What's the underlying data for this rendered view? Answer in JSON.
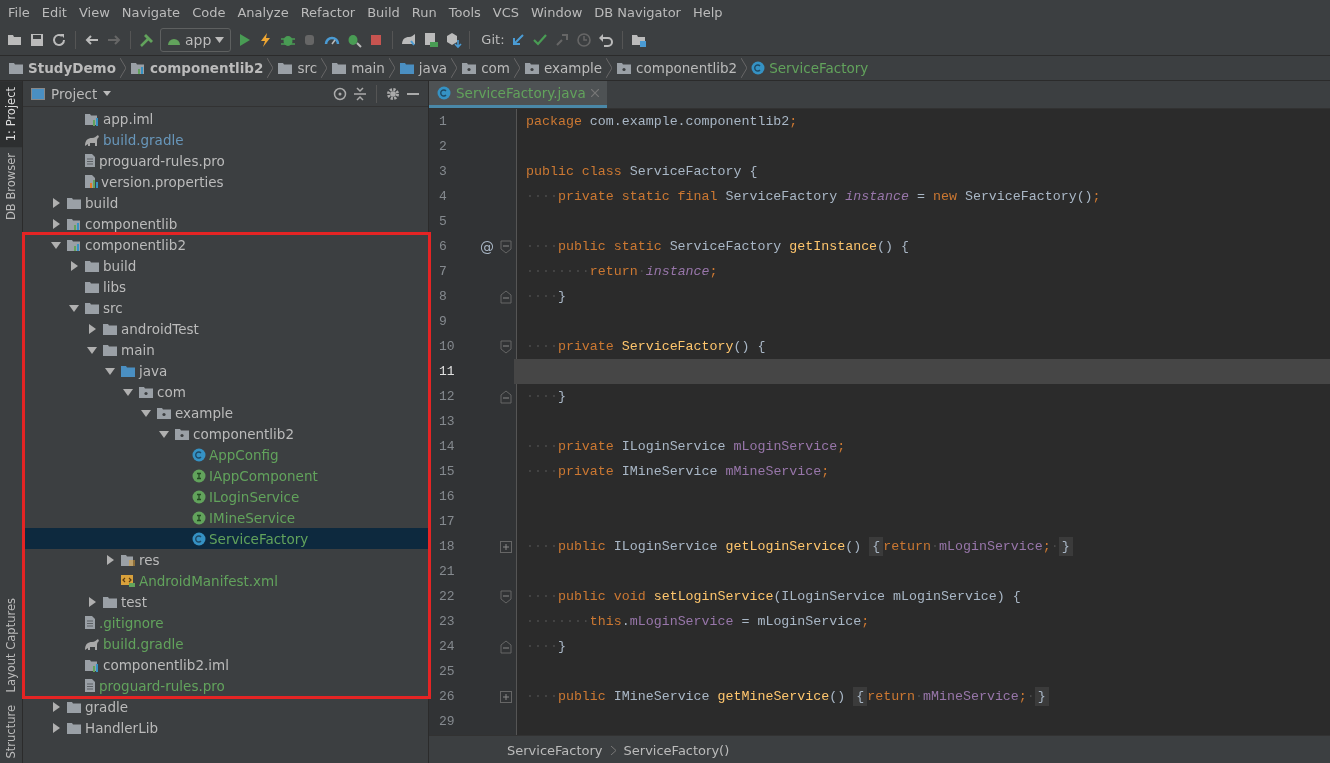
{
  "menu_bar": {
    "items": [
      "File",
      "Edit",
      "View",
      "Navigate",
      "Code",
      "Analyze",
      "Refactor",
      "Build",
      "Run",
      "Tools",
      "VCS",
      "Window",
      "DB Navigator",
      "Help"
    ]
  },
  "toolbar": {
    "run_config": "app",
    "git_label": "Git:"
  },
  "breadcrumb": [
    {
      "label": "StudyDemo",
      "kind": "project"
    },
    {
      "label": "componentlib2",
      "kind": "module"
    },
    {
      "label": "src",
      "kind": "folder"
    },
    {
      "label": "main",
      "kind": "folder"
    },
    {
      "label": "java",
      "kind": "source"
    },
    {
      "label": "com",
      "kind": "package"
    },
    {
      "label": "example",
      "kind": "package"
    },
    {
      "label": "componentlib2",
      "kind": "package"
    },
    {
      "label": "ServiceFactory",
      "kind": "class"
    }
  ],
  "tool_strip": {
    "top": [
      {
        "label": "1: Project",
        "selected": true
      },
      {
        "label": "DB Browser",
        "selected": false
      }
    ],
    "bottom": [
      {
        "label": "Layout Captures",
        "selected": false
      },
      {
        "label": "Structure",
        "selected": false
      }
    ]
  },
  "project_panel": {
    "title": "Project",
    "continued_items": [
      {
        "label": "app.iml",
        "kind": "iml",
        "color": "#bbbbbb",
        "selected": false
      },
      {
        "label": "build.gradle",
        "kind": "gradle",
        "color": "#6897bb",
        "selected": false
      },
      {
        "label": "proguard-rules.pro",
        "kind": "file",
        "color": "#bbbbbb",
        "selected": false
      },
      {
        "label": "version.properties",
        "kind": "properties",
        "color": "#bbbbbb",
        "selected": false
      }
    ],
    "items": [
      {
        "label": "build",
        "kind": "folder",
        "color": "#bbbbbb",
        "selected": false,
        "expanded": false
      },
      {
        "label": "componentlib",
        "kind": "module",
        "color": "#bbbbbb",
        "selected": false,
        "expanded": false
      },
      {
        "label": "componentlib2",
        "kind": "module",
        "color": "#bbbbbb",
        "selected": false,
        "expanded": true,
        "children": [
          {
            "label": "build",
            "kind": "folder",
            "color": "#bbbbbb",
            "selected": false,
            "expanded": false
          },
          {
            "label": "libs",
            "kind": "folder",
            "color": "#bbbbbb",
            "selected": false
          },
          {
            "label": "src",
            "kind": "folder",
            "color": "#bbbbbb",
            "selected": false,
            "expanded": true,
            "children": [
              {
                "label": "androidTest",
                "kind": "folder",
                "color": "#bbbbbb",
                "selected": false,
                "expanded": false
              },
              {
                "label": "main",
                "kind": "folder",
                "color": "#bbbbbb",
                "selected": false,
                "expanded": true,
                "children": [
                  {
                    "label": "java",
                    "kind": "source",
                    "color": "#bbbbbb",
                    "selected": false,
                    "expanded": true,
                    "children": [
                      {
                        "label": "com",
                        "kind": "package",
                        "color": "#bbbbbb",
                        "selected": false,
                        "expanded": true,
                        "children": [
                          {
                            "label": "example",
                            "kind": "package",
                            "color": "#bbbbbb",
                            "selected": false,
                            "expanded": true,
                            "children": [
                              {
                                "label": "componentlib2",
                                "kind": "package",
                                "color": "#bbbbbb",
                                "selected": false,
                                "expanded": true,
                                "children": [
                                  {
                                    "label": "AppConfig",
                                    "kind": "class",
                                    "color": "#62a35c",
                                    "selected": false
                                  },
                                  {
                                    "label": "IAppComponent",
                                    "kind": "interface",
                                    "color": "#62a35c",
                                    "selected": false
                                  },
                                  {
                                    "label": "ILoginService",
                                    "kind": "interface",
                                    "color": "#62a35c",
                                    "selected": false
                                  },
                                  {
                                    "label": "IMineService",
                                    "kind": "interface",
                                    "color": "#62a35c",
                                    "selected": false
                                  },
                                  {
                                    "label": "ServiceFactory",
                                    "kind": "class",
                                    "color": "#62a35c",
                                    "selected": true
                                  }
                                ]
                              }
                            ]
                          }
                        ]
                      }
                    ]
                  },
                  {
                    "label": "res",
                    "kind": "res",
                    "color": "#bbbbbb",
                    "selected": false,
                    "expanded": false
                  },
                  {
                    "label": "AndroidManifest.xml",
                    "kind": "manifest",
                    "color": "#62a35c",
                    "selected": false
                  }
                ]
              },
              {
                "label": "test",
                "kind": "folder",
                "color": "#bbbbbb",
                "selected": false,
                "expanded": false
              }
            ]
          },
          {
            "label": ".gitignore",
            "kind": "file",
            "color": "#62a35c",
            "selected": false
          },
          {
            "label": "build.gradle",
            "kind": "gradle",
            "color": "#62a35c",
            "selected": false
          },
          {
            "label": "componentlib2.iml",
            "kind": "iml",
            "color": "#bbbbbb",
            "selected": false
          },
          {
            "label": "proguard-rules.pro",
            "kind": "file",
            "color": "#62a35c",
            "selected": false
          }
        ]
      },
      {
        "label": "gradle",
        "kind": "folder",
        "color": "#bbbbbb",
        "selected": false,
        "expanded": false
      },
      {
        "label": "HandlerLib",
        "kind": "folder",
        "color": "#bbbbbb",
        "selected": false,
        "expanded": false
      }
    ]
  },
  "editor": {
    "tabs": [
      {
        "label": "ServiceFactory.java",
        "selected": true
      }
    ],
    "lines": [
      {
        "number": "1",
        "current": false,
        "tokens": [
          {
            "t": "package",
            "kind": "kw"
          },
          {
            "t": " com.example.componentlib2",
            "kind": "plain"
          },
          {
            "t": ";",
            "kind": "kw"
          }
        ]
      },
      {
        "number": "2",
        "current": false
      },
      {
        "number": "3",
        "current": false,
        "tokens": [
          {
            "t": "public class",
            "kind": "kw"
          },
          {
            "t": " ServiceFactory {",
            "kind": "plain"
          }
        ]
      },
      {
        "number": "4",
        "current": false,
        "tokens": [
          {
            "t": "····",
            "kind": "ws"
          },
          {
            "t": "private static final",
            "kind": "kw"
          },
          {
            "t": " ServiceFactory ",
            "kind": "plain"
          },
          {
            "t": "instance",
            "kind": "static"
          },
          {
            "t": " = ",
            "kind": "plain"
          },
          {
            "t": "new",
            "kind": "kw"
          },
          {
            "t": " ServiceFactory()",
            "kind": "plain"
          },
          {
            "t": ";",
            "kind": "kw"
          }
        ]
      },
      {
        "number": "5",
        "current": false
      },
      {
        "number": "6",
        "current": false,
        "mark": "@",
        "fold_start": true,
        "tokens": [
          {
            "t": "····",
            "kind": "ws"
          },
          {
            "t": "public static",
            "kind": "kw"
          },
          {
            "t": " ServiceFactory ",
            "kind": "plain"
          },
          {
            "t": "getInstance",
            "kind": "fn"
          },
          {
            "t": "() {",
            "kind": "plain"
          }
        ]
      },
      {
        "number": "7",
        "current": false,
        "tokens": [
          {
            "t": "········",
            "kind": "ws"
          },
          {
            "t": "return",
            "kind": "kw"
          },
          {
            "t": "·",
            "kind": "ws"
          },
          {
            "t": "instance",
            "kind": "static"
          },
          {
            "t": ";",
            "kind": "kw"
          }
        ]
      },
      {
        "number": "8",
        "current": false,
        "fold_end": true,
        "tokens": [
          {
            "t": "····",
            "kind": "ws"
          },
          {
            "t": "}",
            "kind": "plain"
          }
        ]
      },
      {
        "number": "9",
        "current": false
      },
      {
        "number": "10",
        "current": false,
        "fold_start": true,
        "tokens": [
          {
            "t": "····",
            "kind": "ws"
          },
          {
            "t": "private ",
            "kind": "kw"
          },
          {
            "t": "ServiceFactory",
            "kind": "fn"
          },
          {
            "t": "() {",
            "kind": "plain"
          }
        ]
      },
      {
        "number": "11",
        "current": true
      },
      {
        "number": "12",
        "current": false,
        "fold_end": true,
        "tokens": [
          {
            "t": "····",
            "kind": "ws"
          },
          {
            "t": "}",
            "kind": "plain"
          }
        ]
      },
      {
        "number": "13",
        "current": false
      },
      {
        "number": "14",
        "current": false,
        "tokens": [
          {
            "t": "····",
            "kind": "ws"
          },
          {
            "t": "private",
            "kind": "kw"
          },
          {
            "t": " ILoginService ",
            "kind": "plain"
          },
          {
            "t": "mLoginService",
            "kind": "field"
          },
          {
            "t": ";",
            "kind": "kw"
          }
        ]
      },
      {
        "number": "15",
        "current": false,
        "tokens": [
          {
            "t": "····",
            "kind": "ws"
          },
          {
            "t": "private",
            "kind": "kw"
          },
          {
            "t": " IMineService ",
            "kind": "plain"
          },
          {
            "t": "mMineService",
            "kind": "field"
          },
          {
            "t": ";",
            "kind": "kw"
          }
        ]
      },
      {
        "number": "16",
        "current": false
      },
      {
        "number": "17",
        "current": false
      },
      {
        "number": "18",
        "current": false,
        "collapsed": true,
        "tokens": [
          {
            "t": "····",
            "kind": "ws"
          },
          {
            "t": "public",
            "kind": "kw"
          },
          {
            "t": " ILoginService ",
            "kind": "plain"
          },
          {
            "t": "getLoginService",
            "kind": "fn"
          },
          {
            "t": "() ",
            "kind": "plain"
          },
          {
            "t": "{",
            "kind": "foldbrace"
          },
          {
            "t": "return",
            "kind": "kw"
          },
          {
            "t": "·",
            "kind": "ws"
          },
          {
            "t": "mLoginService",
            "kind": "field"
          },
          {
            "t": ";",
            "kind": "kw"
          },
          {
            "t": "·",
            "kind": "ws"
          },
          {
            "t": "}",
            "kind": "foldbrace"
          }
        ]
      },
      {
        "number": "21",
        "current": false
      },
      {
        "number": "22",
        "current": false,
        "fold_start": true,
        "tokens": [
          {
            "t": "····",
            "kind": "ws"
          },
          {
            "t": "public void ",
            "kind": "kw"
          },
          {
            "t": "setLoginService",
            "kind": "fn"
          },
          {
            "t": "(ILoginService mLoginService) {",
            "kind": "plain"
          }
        ]
      },
      {
        "number": "23",
        "current": false,
        "tokens": [
          {
            "t": "········",
            "kind": "ws"
          },
          {
            "t": "this",
            "kind": "kw"
          },
          {
            "t": ".",
            "kind": "plain"
          },
          {
            "t": "mLoginService",
            "kind": "field"
          },
          {
            "t": " = mLoginService",
            "kind": "plain"
          },
          {
            "t": ";",
            "kind": "kw"
          }
        ]
      },
      {
        "number": "24",
        "current": false,
        "fold_end": true,
        "tokens": [
          {
            "t": "····",
            "kind": "ws"
          },
          {
            "t": "}",
            "kind": "plain"
          }
        ]
      },
      {
        "number": "25",
        "current": false
      },
      {
        "number": "26",
        "current": false,
        "collapsed": true,
        "tokens": [
          {
            "t": "····",
            "kind": "ws"
          },
          {
            "t": "public",
            "kind": "kw"
          },
          {
            "t": " IMineService ",
            "kind": "plain"
          },
          {
            "t": "getMineService",
            "kind": "fn"
          },
          {
            "t": "() ",
            "kind": "plain"
          },
          {
            "t": "{",
            "kind": "foldbrace"
          },
          {
            "t": "return",
            "kind": "kw"
          },
          {
            "t": "·",
            "kind": "ws"
          },
          {
            "t": "mMineService",
            "kind": "field"
          },
          {
            "t": ";",
            "kind": "kw"
          },
          {
            "t": "·",
            "kind": "ws"
          },
          {
            "t": "}",
            "kind": "foldbrace"
          }
        ]
      },
      {
        "number": "29",
        "current": false
      }
    ],
    "breadcrumb": [
      "ServiceFactory",
      "ServiceFactory()"
    ]
  }
}
